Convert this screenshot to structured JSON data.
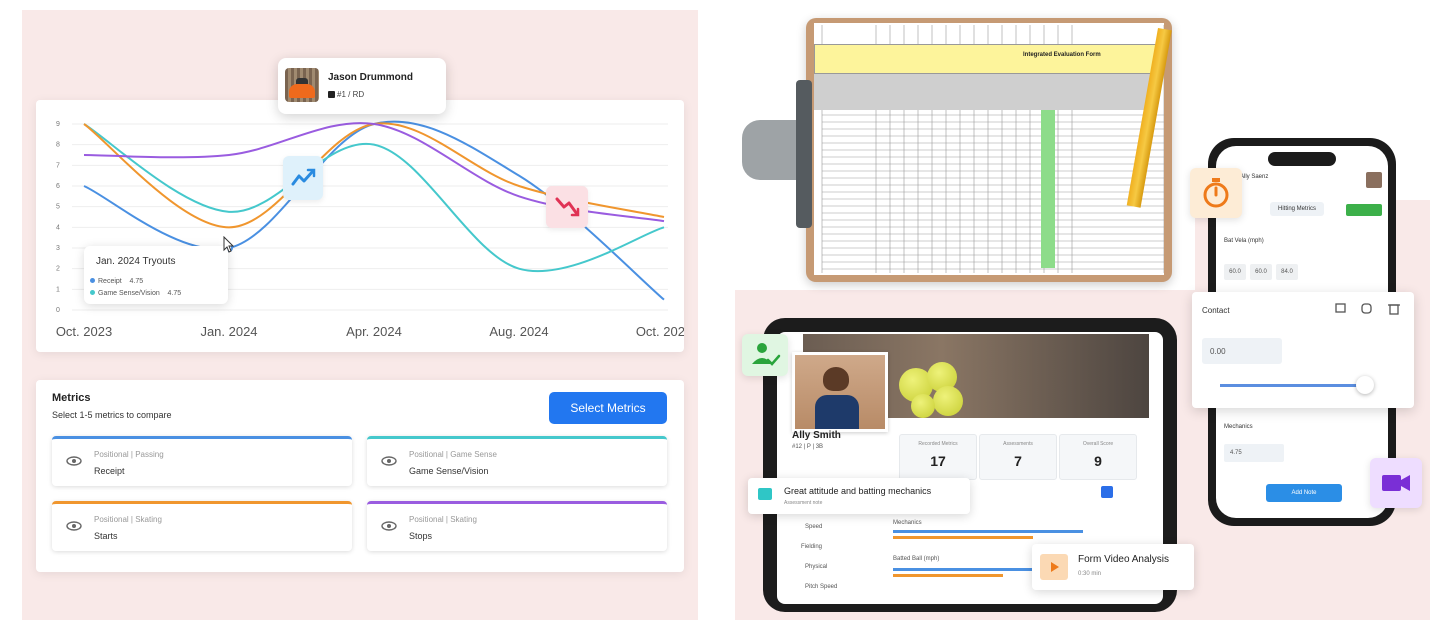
{
  "player": {
    "name": "Jason Drummond",
    "position": "#1 / RD"
  },
  "chart_data": {
    "type": "line",
    "x": [
      "Oct. 2023",
      "Jan. 2024",
      "Apr. 2024",
      "Aug. 2024",
      "Oct. 2024"
    ],
    "ylim": [
      0,
      9
    ],
    "series": [
      {
        "name": "Receipt",
        "color": "#4a90e2",
        "values": [
          6.0,
          3.0,
          9.0,
          6.5,
          0.5
        ]
      },
      {
        "name": "Game Sense/Vision",
        "color": "#45c8cc",
        "values": [
          9.0,
          4.75,
          8.0,
          2.0,
          4.0
        ]
      },
      {
        "name": "Starts",
        "color": "#f0962e",
        "values": [
          9.0,
          4.0,
          9.0,
          6.0,
          4.5
        ]
      },
      {
        "name": "Stops",
        "color": "#9a5ce0",
        "values": [
          7.5,
          7.5,
          9.0,
          5.5,
          4.3
        ]
      }
    ]
  },
  "tooltip": {
    "title": "Jan. 2024 Tryouts",
    "rows": [
      {
        "label": "Receipt",
        "value": "4.75",
        "color": "#4a90e2"
      },
      {
        "label": "Game Sense/Vision",
        "value": "4.75",
        "color": "#45c8cc"
      }
    ]
  },
  "metrics": {
    "title": "Metrics",
    "subtitle": "Select 1-5 metrics to compare",
    "button": "Select Metrics",
    "items": [
      {
        "category": "Positional | Passing",
        "name": "Receipt",
        "color": "#4a90e2"
      },
      {
        "category": "Positional | Game Sense",
        "name": "Game Sense/Vision",
        "color": "#45c8cc"
      },
      {
        "category": "Positional | Skating",
        "name": "Starts",
        "color": "#f0962e"
      },
      {
        "category": "Positional | Skating",
        "name": "Stops",
        "color": "#9a5ce0"
      }
    ]
  },
  "clipboard": {
    "form_title": "Integrated Evaluation Form"
  },
  "phone": {
    "title": "Ally Saenz",
    "tab": "Hitting Metrics",
    "row1": "Bat Vela (mph)",
    "values": [
      "60.0",
      "60.0",
      "84.0"
    ],
    "mechanics": "Mechanics",
    "mechanics_value": "4.75",
    "button": "Add Note"
  },
  "contact": {
    "label": "Contact",
    "value": "0.00"
  },
  "tablet": {
    "athlete_name": "Ally Smith",
    "athlete_sub": "#12 | P | 3B",
    "stats": [
      {
        "label": "Recorded Metrics",
        "value": "17"
      },
      {
        "label": "Assessments",
        "value": "7"
      },
      {
        "label": "Overall Score",
        "value": "9"
      }
    ],
    "side_items": [
      "Speed",
      "Fielding",
      "Physical",
      "Pitch Speed"
    ],
    "bars": [
      "Mechanics",
      "Batted Ball (mph)"
    ]
  },
  "note": {
    "text": "Great attitude and batting mechanics",
    "sub": "Assessment note"
  },
  "video": {
    "title": "Form Video Analysis",
    "sub": "0:30 min"
  }
}
